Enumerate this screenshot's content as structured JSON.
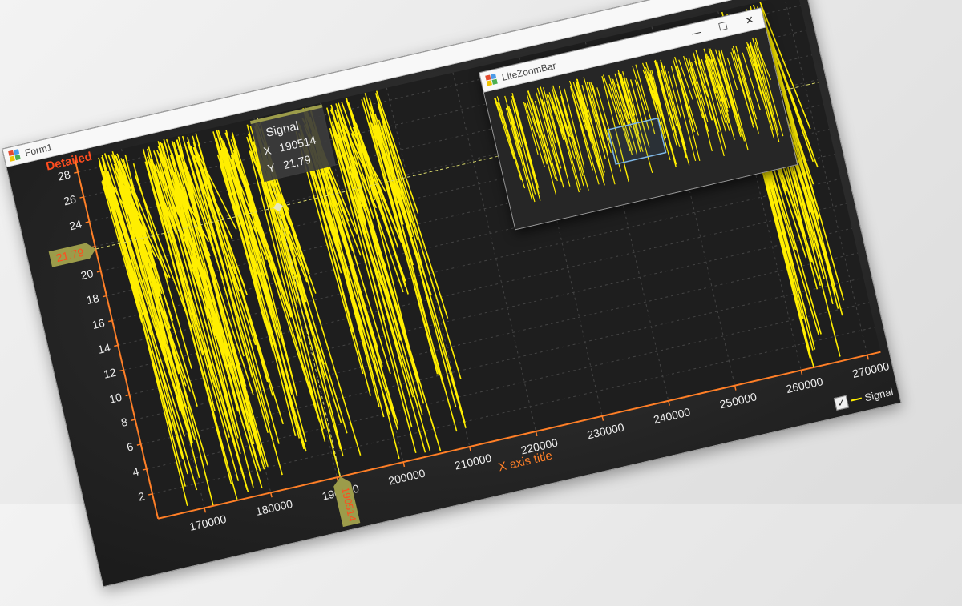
{
  "window": {
    "title": "Form1",
    "controls": {
      "minimize": "—",
      "maximize": "☐",
      "close": "✕"
    }
  },
  "zoom_window": {
    "title": "LiteZoomBar",
    "controls": {
      "minimize": "—",
      "maximize": "☐",
      "close": "✕"
    }
  },
  "chart_data": {
    "type": "line",
    "title": "Detailed",
    "xlabel": "X axis title",
    "ylabel": "",
    "xlim": [
      163000,
      272000
    ],
    "ylim": [
      0,
      29
    ],
    "x_ticks": [
      "170000",
      "180000",
      "190000",
      "200000",
      "210000",
      "220000",
      "230000",
      "240000",
      "250000",
      "260000",
      "270000"
    ],
    "y_ticks": [
      "2",
      "4",
      "6",
      "8",
      "10",
      "12",
      "14",
      "16",
      "18",
      "20",
      "22",
      "24",
      "26",
      "28"
    ],
    "series": [
      {
        "name": "Signal",
        "color": "#ffee00"
      }
    ],
    "grid": true,
    "legend": "bottom-right",
    "cursor": {
      "series_label": "Signal",
      "x_label": "X",
      "x_value": "190514",
      "y_label": "Y",
      "y_value": "21,79",
      "x_axis_marker": "190514",
      "y_axis_marker": "21.79",
      "x": 190514,
      "y": 21.79
    }
  },
  "colors": {
    "signal": "#ffee00",
    "title": "#ff4d1f",
    "axis": "#ff7f27",
    "marker_fill": "#9c9c4a",
    "cursor_value": "#ff4d1f"
  }
}
